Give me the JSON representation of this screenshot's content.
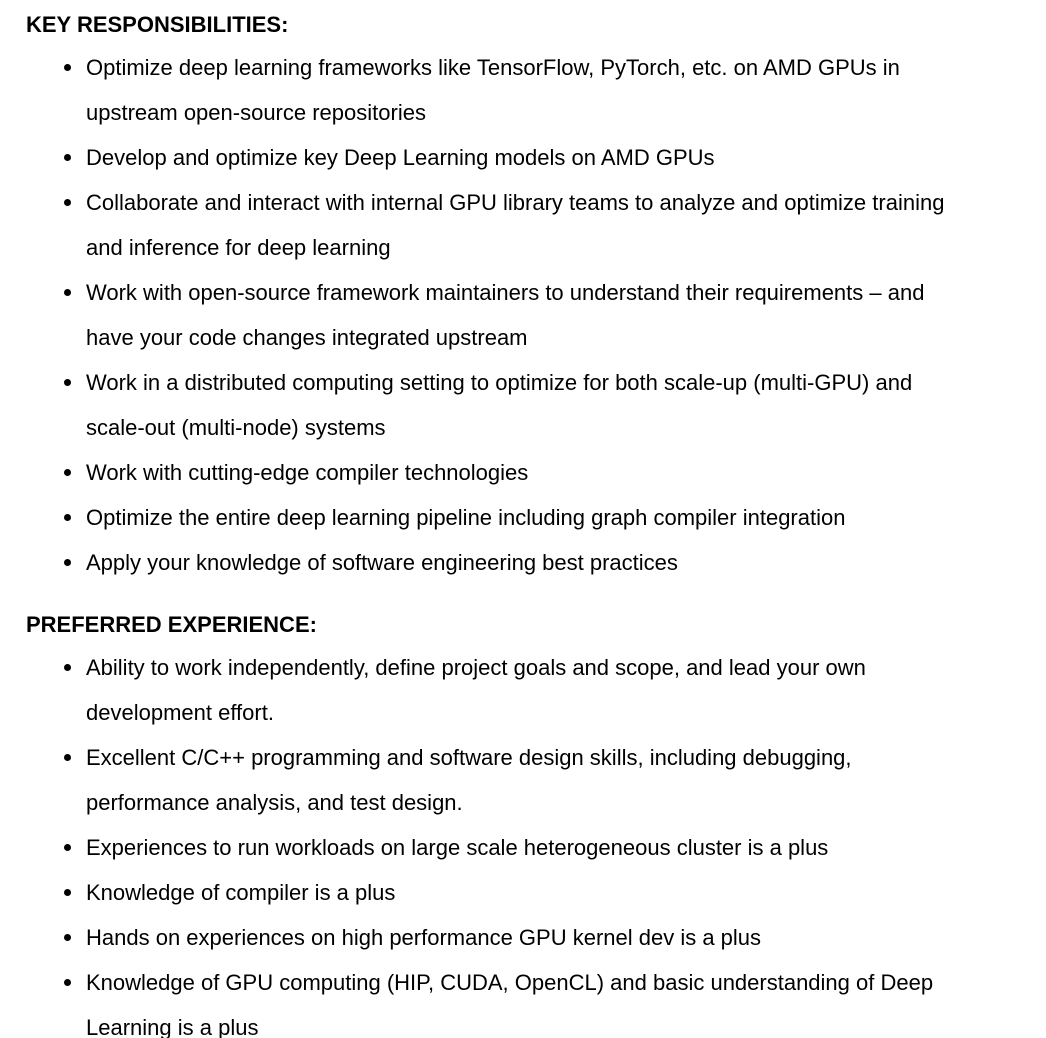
{
  "responsibilities": {
    "heading": "KEY RESPONSIBILITIES:",
    "items": [
      [
        "Optimize deep learning frameworks like TensorFlow, PyTorch, etc. on AMD GPUs in",
        "upstream open-source repositories"
      ],
      [
        "Develop and optimize key Deep Learning models on AMD GPUs"
      ],
      [
        "Collaborate and interact with internal GPU library teams to analyze and optimize training",
        "and inference for deep learning"
      ],
      [
        "Work with open-source framework maintainers to understand their requirements – and",
        "have your code changes integrated upstream"
      ],
      [
        "Work in a distributed computing setting to optimize for both scale-up (multi-GPU) and",
        "scale-out (multi-node) systems"
      ],
      [
        "Work with cutting-edge compiler technologies"
      ],
      [
        "Optimize the entire deep learning pipeline including graph compiler integration"
      ],
      [
        "Apply your knowledge of software engineering best practices"
      ]
    ]
  },
  "experience": {
    "heading": "PREFERRED EXPERIENCE:",
    "items": [
      [
        "Ability to work independently, define project goals and scope, and lead your own",
        "development effort."
      ],
      [
        "Excellent C/C++ programming and software design skills, including debugging,",
        "performance analysis, and test design."
      ],
      [
        "Experiences to run workloads on large scale heterogeneous cluster is a plus"
      ],
      [
        "Knowledge of compiler is a plus"
      ],
      [
        "Hands on experiences on high performance GPU kernel dev is a plus"
      ],
      [
        "Knowledge of GPU computing (HIP, CUDA, OpenCL) and basic understanding of Deep",
        "Learning is a plus"
      ]
    ]
  }
}
